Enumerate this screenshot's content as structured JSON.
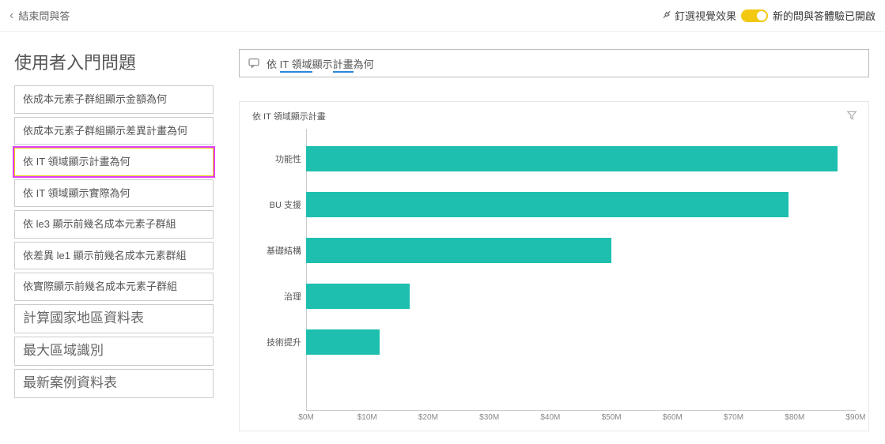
{
  "header": {
    "back_label": "結束問與答",
    "pin_label": "釘選視覺效果",
    "toggle_label": "新的問與答體驗已開啟"
  },
  "sidebar": {
    "title": "使用者入門問題",
    "items": [
      {
        "label": "依成本元素子群組顯示金額為何",
        "selected": false
      },
      {
        "label": "依成本元素子群組顯示差異計畫為何",
        "selected": false
      },
      {
        "label": "依 IT 領域顯示計畫為何",
        "selected": true
      },
      {
        "label": "依 IT 領域顯示實際為何",
        "selected": false
      },
      {
        "label": "依 le3 顯示前幾名成本元素子群組",
        "selected": false
      },
      {
        "label": "依差異 le1 顯示前幾名成本元素群組",
        "selected": false
      },
      {
        "label": "依實際顯示前幾名成本元素子群組",
        "selected": false
      },
      {
        "label": "計算國家地區資料表",
        "selected": false
      },
      {
        "label": "最大區域識別",
        "selected": false
      },
      {
        "label": "最新案例資料表",
        "selected": false
      }
    ]
  },
  "query": {
    "prefix": "依 ",
    "kw1": "IT 領域",
    "mid": "顯示",
    "kw2": "計畫",
    "suffix": "為何"
  },
  "card": {
    "title": "依 IT 領域顯示計畫"
  },
  "chart_data": {
    "type": "bar",
    "orientation": "horizontal",
    "categories": [
      "功能性",
      "BU 支援",
      "基礎結構",
      "治理",
      "技術提升"
    ],
    "values": [
      87,
      79,
      50,
      17,
      12
    ],
    "unit": "M",
    "xlabel": "",
    "ylabel": "",
    "xlim": [
      0,
      90
    ],
    "x_ticks": [
      0,
      10,
      20,
      30,
      40,
      50,
      60,
      70,
      80,
      90
    ],
    "x_tick_labels": [
      "$0M",
      "$10M",
      "$20M",
      "$30M",
      "$40M",
      "$50M",
      "$60M",
      "$70M",
      "$80M",
      "$90M"
    ],
    "bar_color": "#1ebfae"
  }
}
